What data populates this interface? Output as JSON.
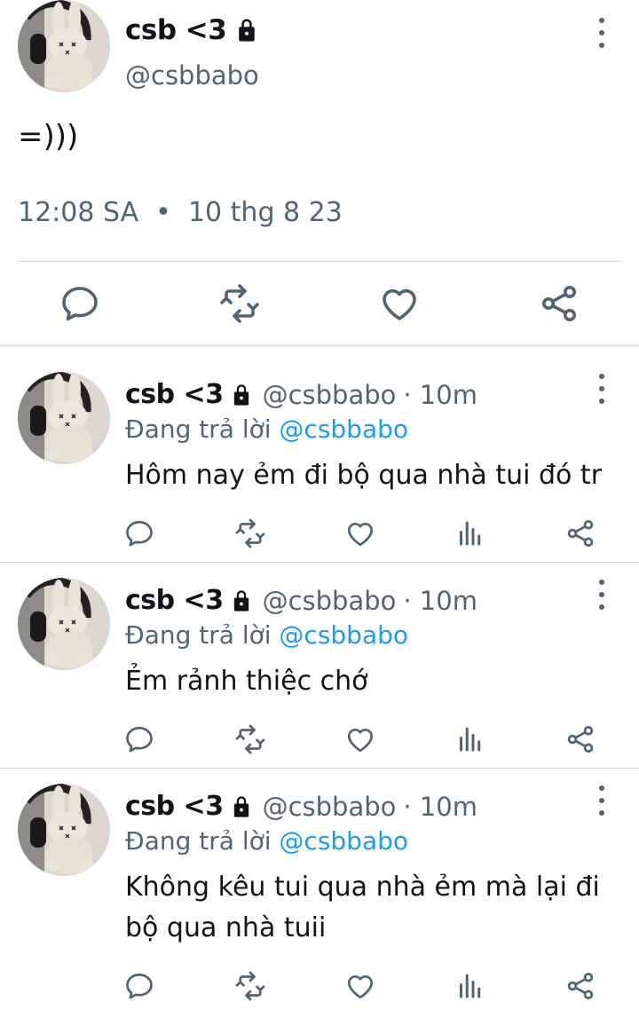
{
  "main_tweet": {
    "display_name": "csb <3",
    "handle": "@csbbabo",
    "text": "=)))",
    "meta": "12:08 SA  •  10 thg 8 23",
    "icons": {
      "lock": "lock-icon",
      "more": "more-vertical-icon",
      "reply": "reply-icon",
      "retweet": "retweet-icon",
      "like": "heart-icon",
      "share": "share-icon"
    }
  },
  "replies": [
    {
      "display_name": "csb <3",
      "handle": "@csbbabo",
      "time": "· 10m",
      "replying_prefix": "Đang trả lời ",
      "replying_to": "@csbbabo",
      "text": "Hôm nay ẻm đi bộ qua nhà tui đó tr"
    },
    {
      "display_name": "csb <3",
      "handle": "@csbbabo",
      "time": "· 10m",
      "replying_prefix": "Đang trả lời ",
      "replying_to": "@csbbabo",
      "text": "Ẻm rảnh thiệc chớ"
    },
    {
      "display_name": "csb <3",
      "handle": "@csbbabo",
      "time": "· 10m",
      "replying_prefix": "Đang trả lời ",
      "replying_to": "@csbbabo",
      "text": "Không kêu tui qua nhà ẻm mà lại đi bộ qua nhà tuii"
    }
  ],
  "colors": {
    "text": "#0f1419",
    "secondary": "#536471",
    "mention": "#1d9bf0",
    "divider": "#cfd9de"
  }
}
